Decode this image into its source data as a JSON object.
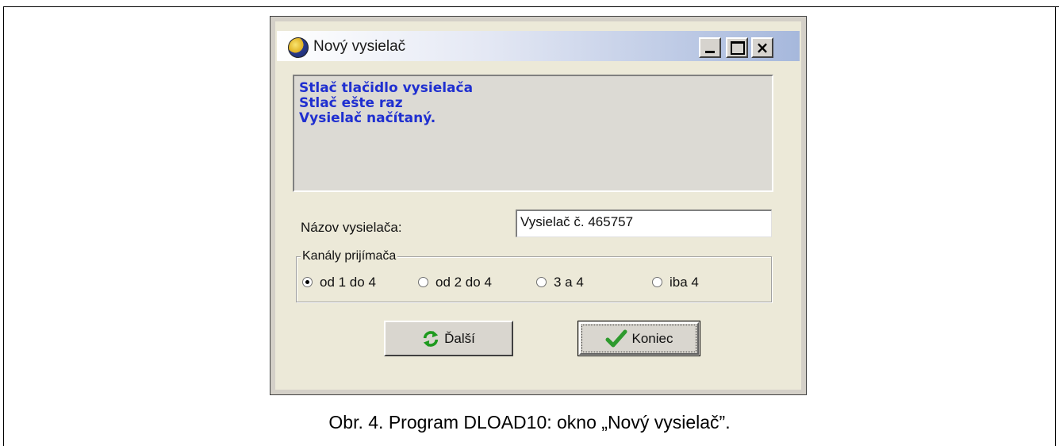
{
  "window": {
    "title": "Nový vysielač",
    "controls": {
      "minimize": "_",
      "maximize": "□",
      "close": "×"
    }
  },
  "log": {
    "lines": [
      "Stlač tlačidlo vysielača",
      "Stlač ešte raz",
      "Vysielač načítaný."
    ]
  },
  "form": {
    "name_label": "Názov vysielača:",
    "name_value": "Vysielač č. 465757"
  },
  "channels": {
    "legend": "Kanály prijímača",
    "options": [
      {
        "label": "od 1 do 4",
        "checked": true
      },
      {
        "label": "od 2 do 4",
        "checked": false
      },
      {
        "label": "3 a 4",
        "checked": false
      },
      {
        "label": "iba 4",
        "checked": false
      }
    ]
  },
  "buttons": {
    "next": {
      "label": "Ďalší",
      "icon": "refresh-icon"
    },
    "end": {
      "label": "Koniec",
      "icon": "checkmark-icon"
    }
  },
  "caption": "Obr. 4. Program DLOAD10: okno „Nový vysielač”.",
  "colors": {
    "log_text": "#1f2fd0",
    "check_icon": "#2e9a2e",
    "refresh_icon": "#1e9a1e"
  }
}
